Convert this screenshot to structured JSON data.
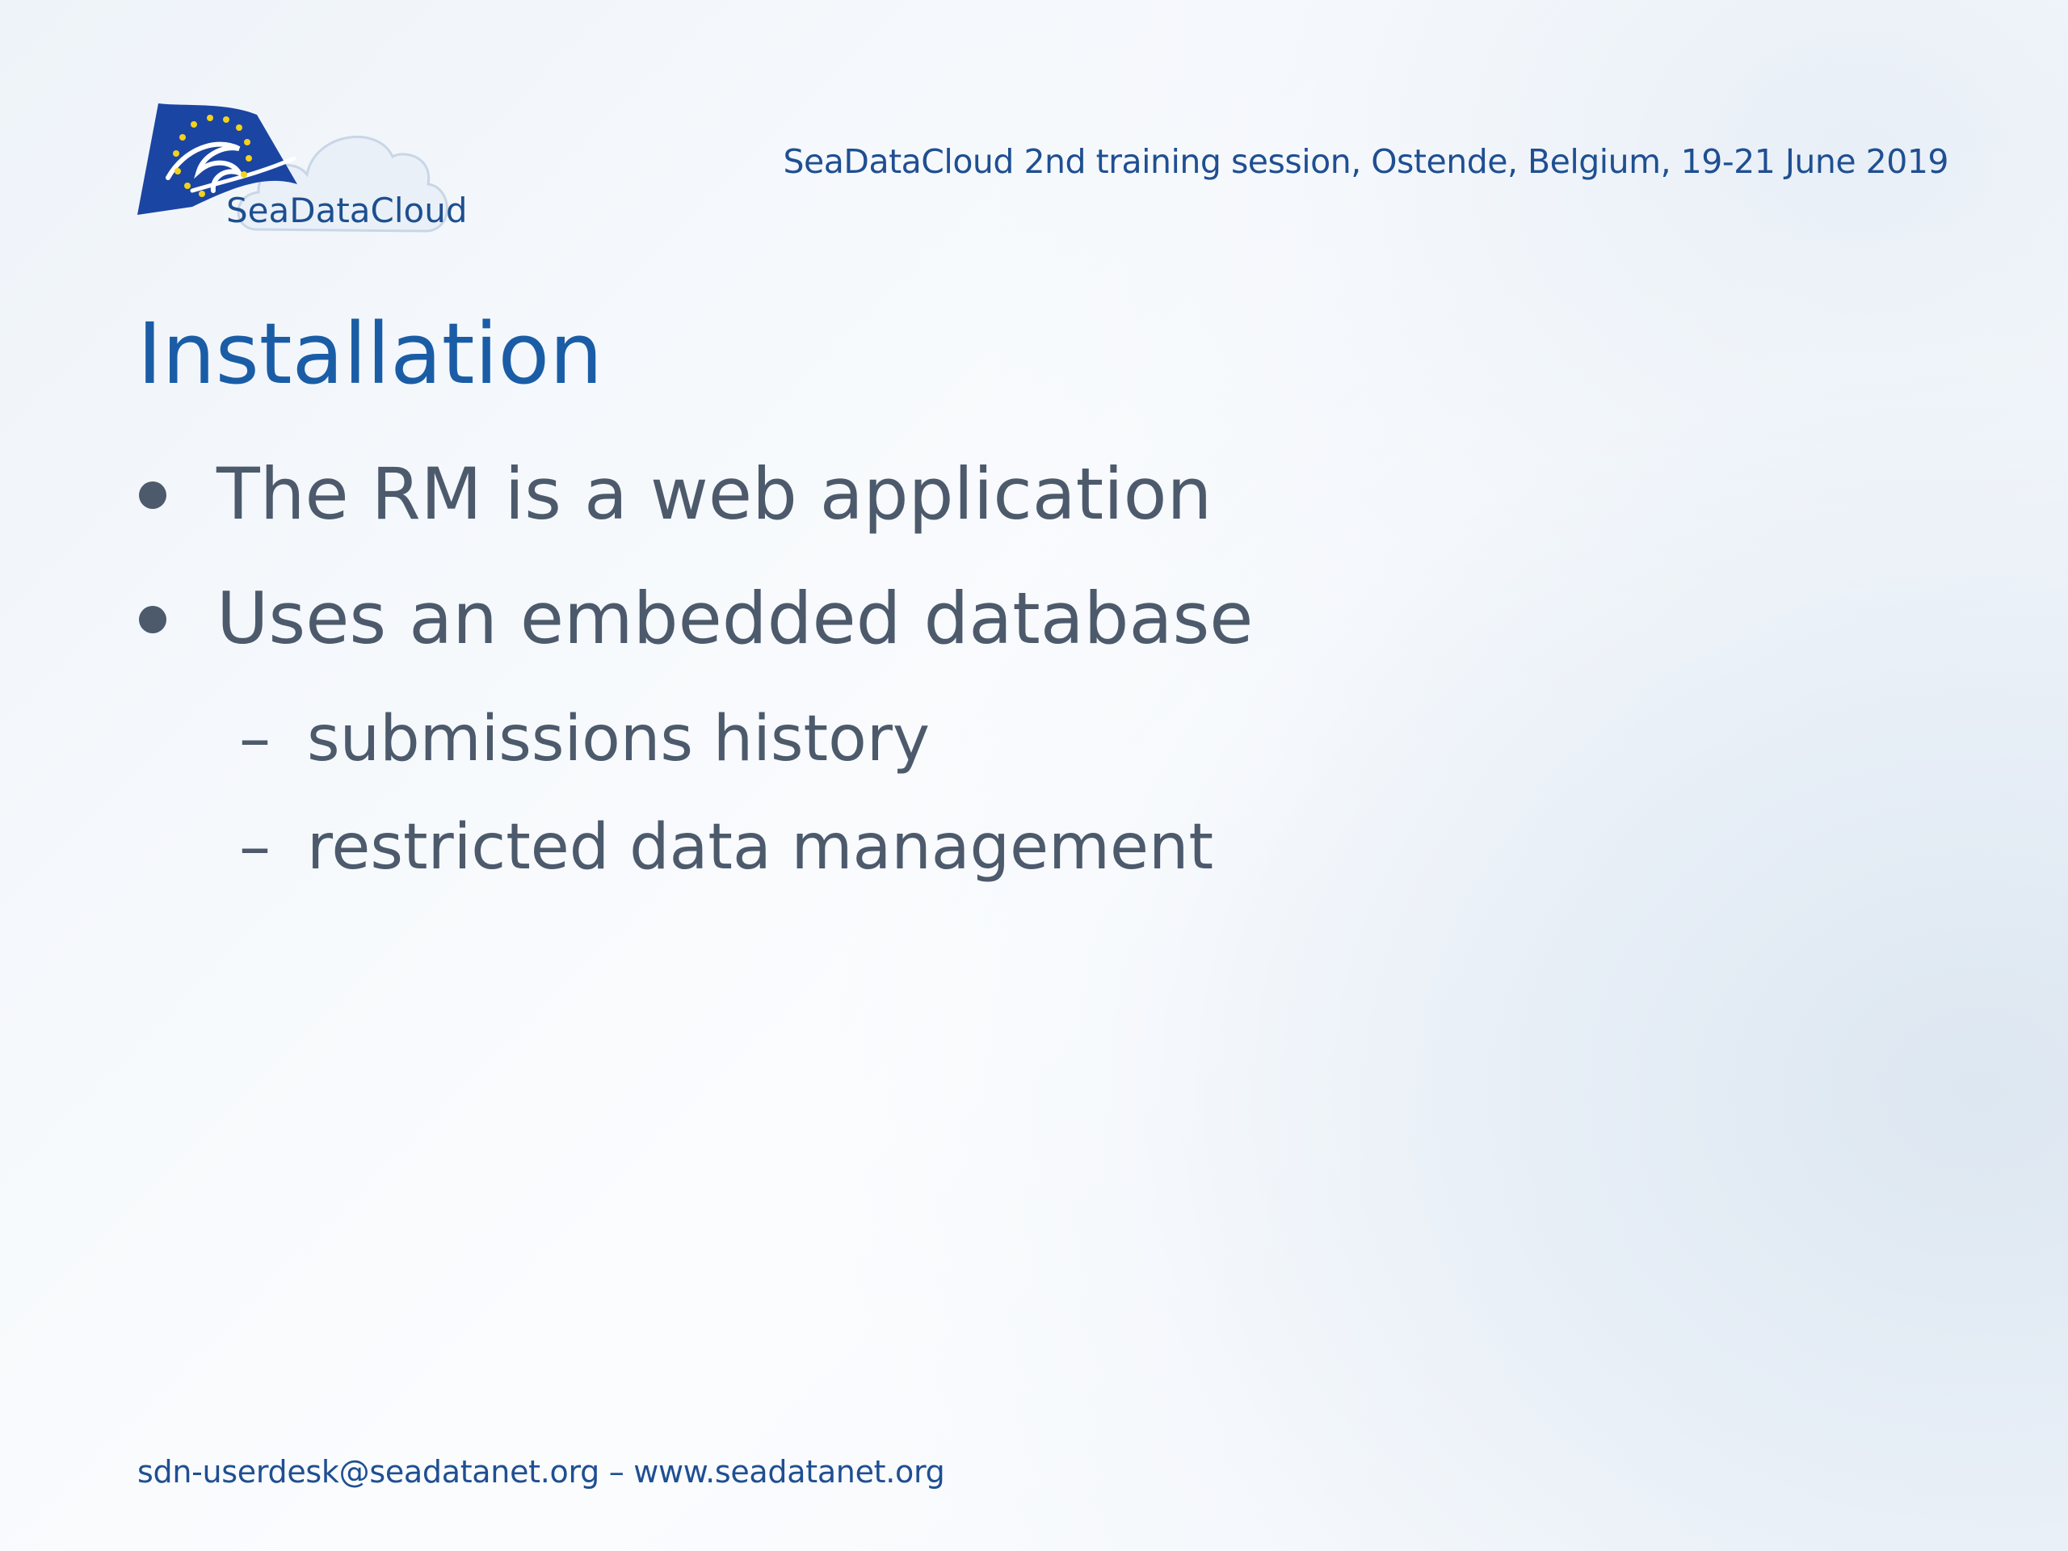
{
  "logo": {
    "text": "SeaDataCloud",
    "icon": "eu-flag-wave-cloud-logo",
    "colors": {
      "flag": "#1a44a0",
      "stars": "#f4d21a",
      "cloud": "#e9eff7",
      "text": "#1d4f8f"
    }
  },
  "header": {
    "text": "SeaDataCloud 2nd training session, Ostende, Belgium, 19-21 June 2019"
  },
  "title": "Installation",
  "bullets": [
    {
      "text": "The RM is a web application"
    },
    {
      "text": "Uses an embedded database"
    }
  ],
  "sub_bullets": [
    {
      "marker": "–",
      "text": "submissions history"
    },
    {
      "marker": "–",
      "text": "restricted data management"
    }
  ],
  "footer": {
    "text": "sdn-userdesk@seadatanet.org – www.seadatanet.org"
  },
  "colors": {
    "title": "#1a5da6",
    "body": "#4c5a6c",
    "header": "#1f4f92"
  }
}
